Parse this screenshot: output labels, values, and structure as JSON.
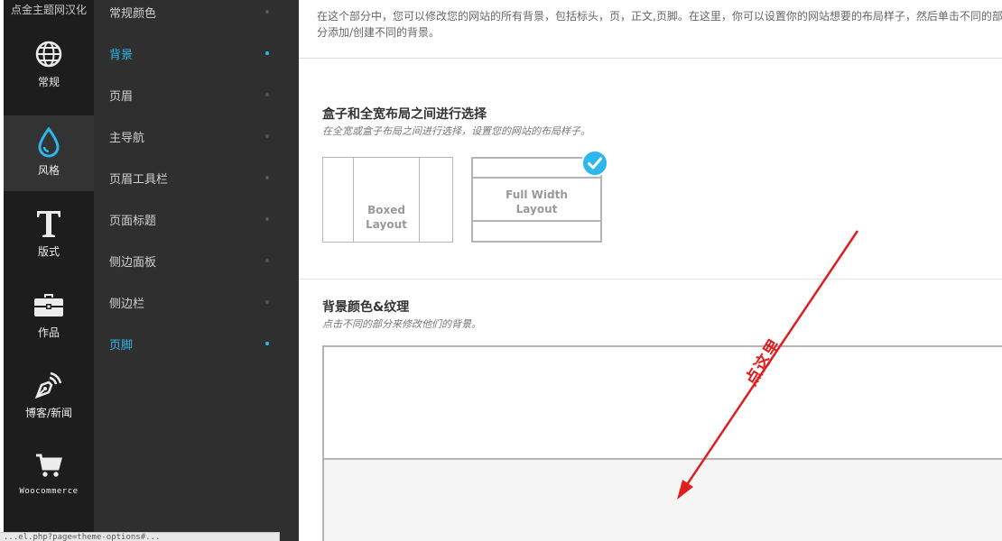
{
  "brand": {
    "label": "点金主题网汉化"
  },
  "icon_sidebar": {
    "items": [
      {
        "label": "常规",
        "icon": "globe-icon"
      },
      {
        "label": "风格",
        "icon": "droplet-icon"
      },
      {
        "label": "版式",
        "icon": "typography-icon"
      },
      {
        "label": "作品",
        "icon": "briefcase-icon"
      },
      {
        "label": "博客/新闻",
        "icon": "pen-nib-icon"
      },
      {
        "label": "Woocommerce",
        "icon": "cart-icon"
      }
    ],
    "active_index": 1
  },
  "sub_menu": {
    "items": [
      {
        "label": "常规颜色"
      },
      {
        "label": "背景"
      },
      {
        "label": "页眉"
      },
      {
        "label": "主导航"
      },
      {
        "label": "页眉工具栏"
      },
      {
        "label": "页面标题"
      },
      {
        "label": "侧边面板"
      },
      {
        "label": "侧边栏"
      },
      {
        "label": "页脚"
      }
    ],
    "active_indexes": [
      1,
      8
    ],
    "accent": "#2eb7ef"
  },
  "main": {
    "intro": "在这个部分中，您可以修改您的网站的所有背景，包括标头，页，正文,页脚。在这里，你可以设置你的网站想要的布局样子，然后单击不同的部分添加/创建不同的背景。",
    "layout_section": {
      "title": "盒子和全宽布局之间进行选择",
      "desc": "在全宽或盒子布局之间进行选择，设置您的网站的布局样子。",
      "options": [
        {
          "label_line1": "Boxed",
          "label_line2": "Layout",
          "selected": false
        },
        {
          "label_line1": "Full Width",
          "label_line2": "Layout",
          "selected": true
        }
      ],
      "selected_icon": "checkmark-icon"
    },
    "bg_section": {
      "title": "背景颜色&纹理",
      "desc": "点击不同的部分来修改他们的背景。"
    }
  },
  "annotation": {
    "text": "点这里",
    "color": "#e01e1e"
  },
  "status_url": "...el.php?page=theme-options#..."
}
